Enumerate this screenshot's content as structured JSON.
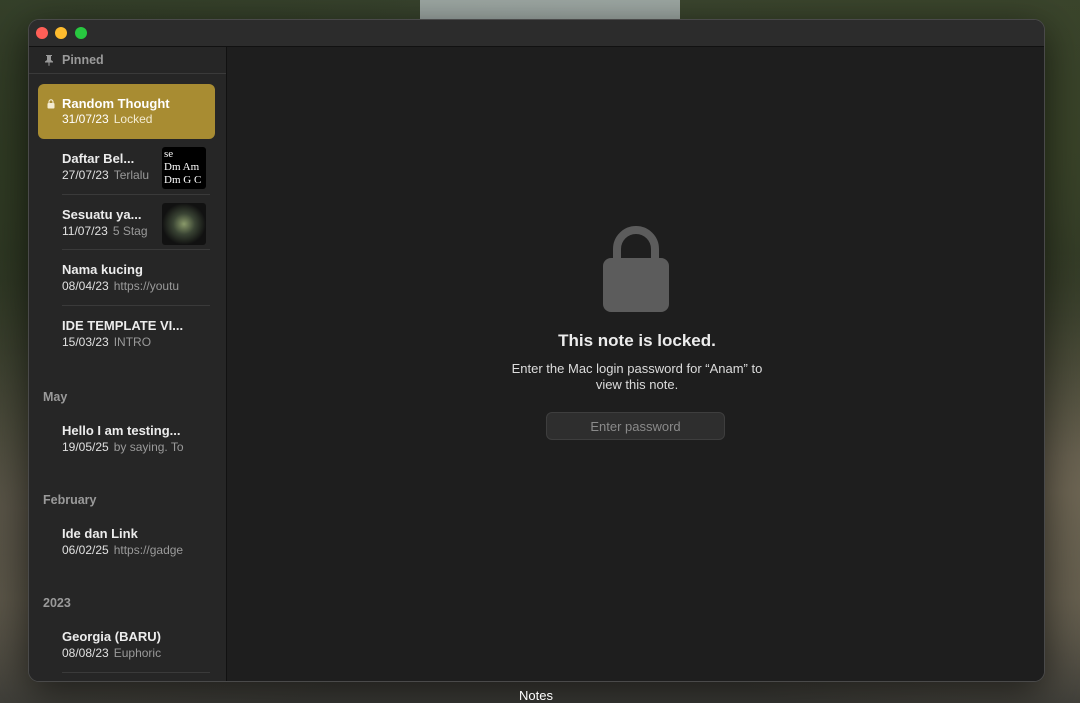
{
  "app": {
    "dock_label": "Notes"
  },
  "sidebar": {
    "pinned_label": "Pinned",
    "pinned_notes": [
      {
        "title": "Random Thought",
        "date": "31/07/23",
        "preview": "Locked",
        "locked": true,
        "selected": true
      },
      {
        "title": "Daftar Bel...",
        "date": "27/07/23",
        "preview": "Terlalu",
        "thumb_text": "se\nDm Am\nDm G C"
      },
      {
        "title": "Sesuatu ya...",
        "date": "11/07/23",
        "preview": "5 Stag"
      },
      {
        "title": "Nama kucing",
        "date": "08/04/23",
        "preview": "https://youtu"
      },
      {
        "title": "IDE TEMPLATE VI...",
        "date": "15/03/23",
        "preview": "INTRO"
      }
    ],
    "sections": [
      {
        "label": "May",
        "notes": [
          {
            "title": "Hello I am testing...",
            "date": "19/05/25",
            "preview": "by saying. To"
          }
        ]
      },
      {
        "label": "February",
        "notes": [
          {
            "title": "Ide dan Link",
            "date": "06/02/25",
            "preview": "https://gadge"
          }
        ]
      },
      {
        "label": "2023",
        "notes": [
          {
            "title": "Georgia (BARU)",
            "date": "08/08/23",
            "preview": "Euphoric"
          }
        ]
      }
    ]
  },
  "main": {
    "locked_title": "This note is locked.",
    "locked_description": "Enter the Mac login password for “Anam” to view this note.",
    "password_placeholder": "Enter password"
  },
  "colors": {
    "selected": "#a88c32",
    "window_bg": "#1e1e1e",
    "sidebar_bg": "#262626"
  }
}
